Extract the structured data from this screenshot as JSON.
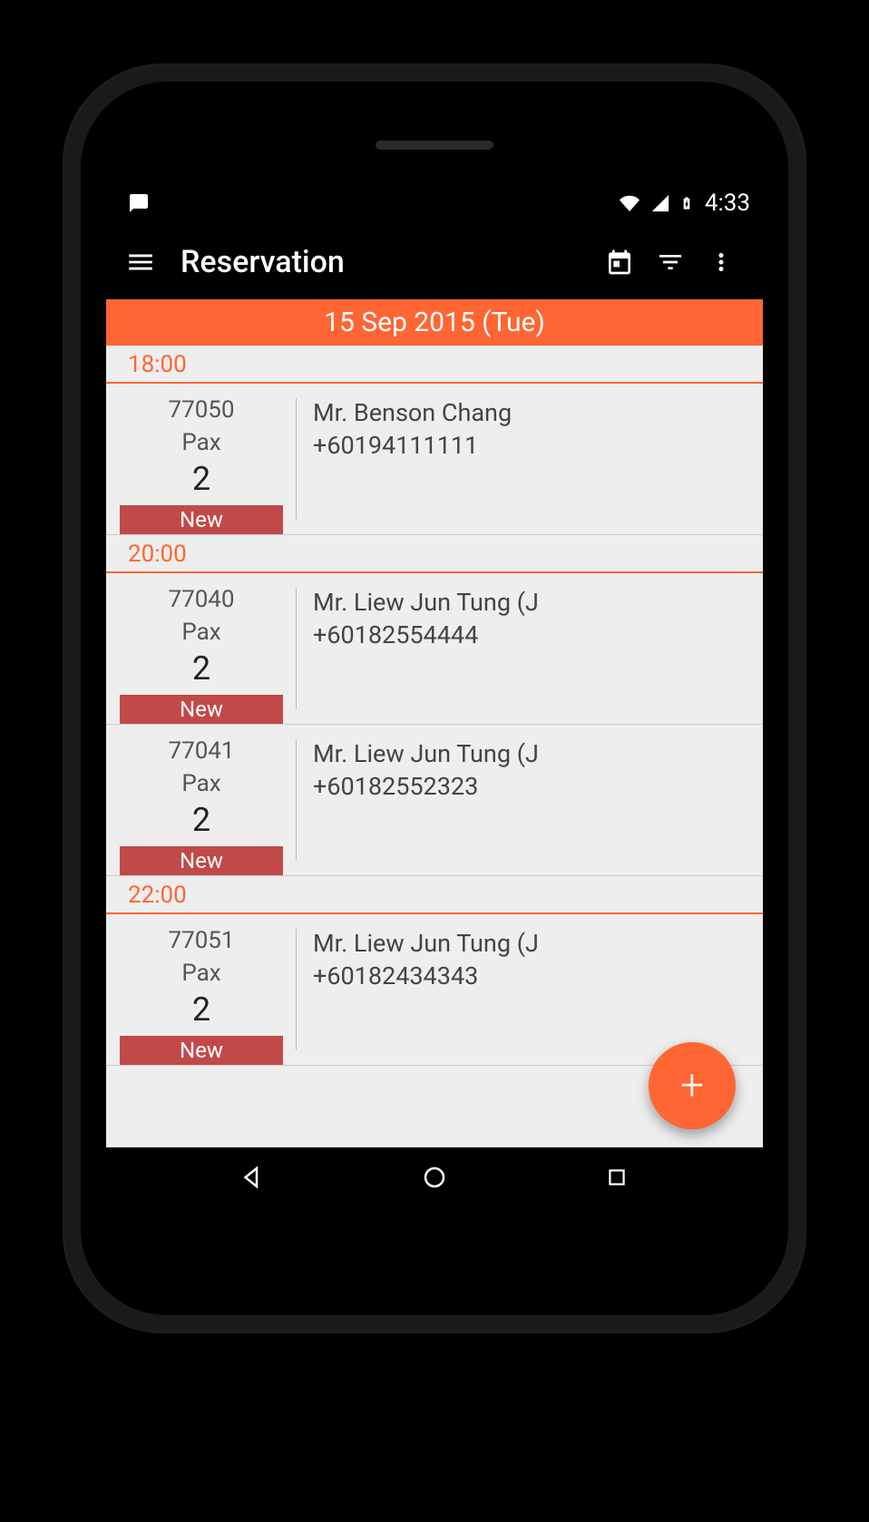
{
  "status": {
    "time": "4:33"
  },
  "appbar": {
    "title": "Reservation"
  },
  "date_banner": "15 Sep 2015 (Tue)",
  "colors": {
    "accent": "#ff6633",
    "badge": "#c14a48"
  },
  "sections": [
    {
      "time": "18:00",
      "items": [
        {
          "id": "77050",
          "pax_label": "Pax",
          "pax": "2",
          "badge": "New",
          "name": "Mr. Benson Chang",
          "phone": "+60194111111"
        }
      ]
    },
    {
      "time": "20:00",
      "items": [
        {
          "id": "77040",
          "pax_label": "Pax",
          "pax": "2",
          "badge": "New",
          "name": "Mr. Liew Jun Tung (J",
          "phone": "+60182554444"
        },
        {
          "id": "77041",
          "pax_label": "Pax",
          "pax": "2",
          "badge": "New",
          "name": "Mr. Liew Jun Tung (J",
          "phone": "+60182552323"
        }
      ]
    },
    {
      "time": "22:00",
      "items": [
        {
          "id": "77051",
          "pax_label": "Pax",
          "pax": "2",
          "badge": "New",
          "name": "Mr. Liew Jun Tung (J",
          "phone": "+60182434343"
        }
      ]
    }
  ]
}
